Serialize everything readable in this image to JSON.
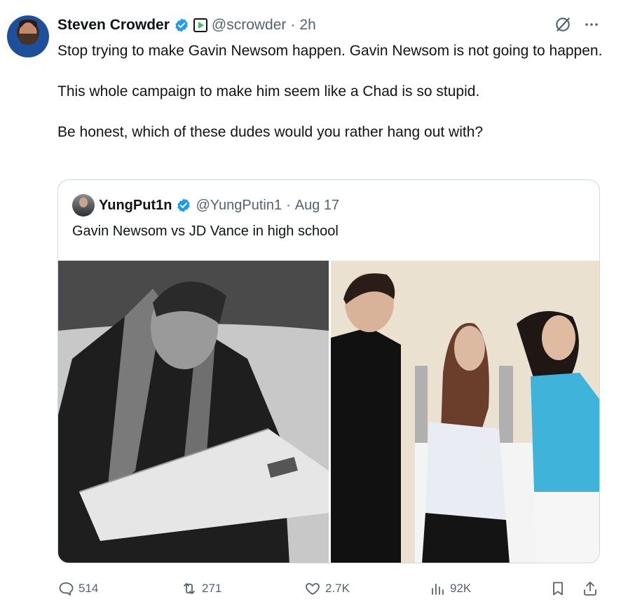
{
  "author": {
    "name": "Steven Crowder",
    "handle": "@scrowder",
    "time": "2h"
  },
  "tweet": {
    "text": "Stop trying to make Gavin Newsom happen. Gavin Newsom is not going to happen.\n\nThis whole campaign to make him seem like a Chad is so stupid.\n\nBe honest, which of these dudes would you rather hang out with?"
  },
  "quote": {
    "name": "YungPut1n",
    "handle": "@YungPutin1",
    "time": "Aug 17",
    "text": "Gavin Newsom vs JD Vance in high school"
  },
  "stats": {
    "replies": "514",
    "reposts": "271",
    "likes": "2.7K",
    "views": "92K"
  },
  "colors": {
    "verified": "#1d9bf0",
    "muted": "#536471",
    "border": "#cfd9de"
  },
  "icons": [
    "verified-icon",
    "brand-badge-icon",
    "grok-icon",
    "more-icon",
    "reply-icon",
    "repost-icon",
    "like-icon",
    "views-icon",
    "bookmark-icon",
    "share-icon"
  ]
}
